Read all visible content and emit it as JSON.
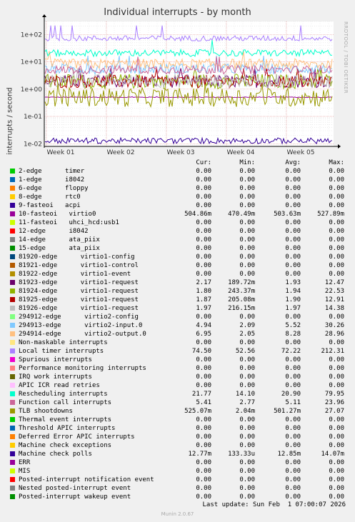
{
  "chart_data": {
    "type": "line",
    "title": "Individual interrupts - by month",
    "ylabel": "interrupts / second",
    "yscale": "log",
    "ylim": [
      0.008,
      300
    ],
    "yticks": [
      "1e+02",
      "1e+01",
      "1e+00",
      "1e-01",
      "1e-02"
    ],
    "ytick_values": [
      100,
      10,
      1,
      0.1,
      0.01
    ],
    "xticks": [
      "Week 01",
      "Week 02",
      "Week 03",
      "Week 04",
      "Week 05"
    ],
    "grid": true,
    "legend_headers": {
      "cur": "Cur:",
      "min": "Min:",
      "avg": "Avg:",
      "max": "Max:"
    },
    "series": [
      {
        "name": "2-edge      timer",
        "color": "#00cc00",
        "cur": "0.00",
        "min": "0.00",
        "avg": "0.00",
        "max": "0.00"
      },
      {
        "name": "1-edge      i8042",
        "color": "#0066b3",
        "cur": "0.00",
        "min": "0.00",
        "avg": "0.00",
        "max": "0.00"
      },
      {
        "name": "6-edge      floppy",
        "color": "#ff8000",
        "cur": "0.00",
        "min": "0.00",
        "avg": "0.00",
        "max": "0.00"
      },
      {
        "name": "8-edge      rtc0",
        "color": "#ffcc00",
        "cur": "0.00",
        "min": "0.00",
        "avg": "0.00",
        "max": "0.00"
      },
      {
        "name": "9-fasteoi   acpi",
        "color": "#330099",
        "cur": "0.00",
        "min": "0.00",
        "avg": "0.00",
        "max": "0.00"
      },
      {
        "name": "10-fasteoi   virtio0",
        "color": "#990099",
        "cur": "504.86m",
        "min": "470.49m",
        "avg": "503.63m",
        "max": "527.89m"
      },
      {
        "name": "11-fasteoi   uhci_hcd:usb1",
        "color": "#ccff00",
        "cur": "0.00",
        "min": "0.00",
        "avg": "0.00",
        "max": "0.00"
      },
      {
        "name": "12-edge      i8042",
        "color": "#ff0000",
        "cur": "0.00",
        "min": "0.00",
        "avg": "0.00",
        "max": "0.00"
      },
      {
        "name": "14-edge      ata_piix",
        "color": "#808080",
        "cur": "0.00",
        "min": "0.00",
        "avg": "0.00",
        "max": "0.00"
      },
      {
        "name": "15-edge      ata_piix",
        "color": "#008f00",
        "cur": "0.00",
        "min": "0.00",
        "avg": "0.00",
        "max": "0.00"
      },
      {
        "name": "81920-edge      virtio1-config",
        "color": "#00487d",
        "cur": "0.00",
        "min": "0.00",
        "avg": "0.00",
        "max": "0.00"
      },
      {
        "name": "81921-edge      virtio1-control",
        "color": "#b35a00",
        "cur": "0.00",
        "min": "0.00",
        "avg": "0.00",
        "max": "0.00"
      },
      {
        "name": "81922-edge      virtio1-event",
        "color": "#b38f00",
        "cur": "0.00",
        "min": "0.00",
        "avg": "0.00",
        "max": "0.00"
      },
      {
        "name": "81923-edge      virtio1-request",
        "color": "#6b006b",
        "cur": "2.17",
        "min": "189.72m",
        "avg": "1.93",
        "max": "12.47"
      },
      {
        "name": "81924-edge      virtio1-request",
        "color": "#8fb300",
        "cur": "1.80",
        "min": "243.37m",
        "avg": "1.94",
        "max": "22.53"
      },
      {
        "name": "81925-edge      virtio1-request",
        "color": "#b30000",
        "cur": "1.87",
        "min": "205.08m",
        "avg": "1.90",
        "max": "12.91"
      },
      {
        "name": "81926-edge      virtio1-request",
        "color": "#bebebe",
        "cur": "1.97",
        "min": "216.15m",
        "avg": "1.97",
        "max": "14.38"
      },
      {
        "name": "294912-edge      virtio2-config",
        "color": "#80ff80",
        "cur": "0.00",
        "min": "0.00",
        "avg": "0.00",
        "max": "0.00"
      },
      {
        "name": "294913-edge      virtio2-input.0",
        "color": "#80c9ff",
        "cur": "4.94",
        "min": "2.09",
        "avg": "5.52",
        "max": "30.26"
      },
      {
        "name": "294914-edge      virtio2-output.0",
        "color": "#ffc080",
        "cur": "6.95",
        "min": "2.05",
        "avg": "8.28",
        "max": "28.96"
      },
      {
        "name": "Non-maskable interrupts",
        "color": "#ffe680",
        "cur": "0.00",
        "min": "0.00",
        "avg": "0.00",
        "max": "0.00"
      },
      {
        "name": "Local timer interrupts",
        "color": "#aa80ff",
        "cur": "74.50",
        "min": "52.56",
        "avg": "72.22",
        "max": "212.31"
      },
      {
        "name": "Spurious interrupts",
        "color": "#ee00cc",
        "cur": "0.00",
        "min": "0.00",
        "avg": "0.00",
        "max": "0.00"
      },
      {
        "name": "Performance monitoring interrupts",
        "color": "#ff8080",
        "cur": "0.00",
        "min": "0.00",
        "avg": "0.00",
        "max": "0.00"
      },
      {
        "name": "IRQ work interrupts",
        "color": "#666600",
        "cur": "0.00",
        "min": "0.00",
        "avg": "0.00",
        "max": "0.00"
      },
      {
        "name": "APIC ICR read retries",
        "color": "#ffbfff",
        "cur": "0.00",
        "min": "0.00",
        "avg": "0.00",
        "max": "0.00"
      },
      {
        "name": "Rescheduling interrupts",
        "color": "#00ffcc",
        "cur": "21.77",
        "min": "14.10",
        "avg": "20.90",
        "max": "79.95"
      },
      {
        "name": "Function call interrupts",
        "color": "#cc6699",
        "cur": "5.41",
        "min": "2.77",
        "avg": "5.11",
        "max": "23.96"
      },
      {
        "name": "TLB shootdowns",
        "color": "#999900",
        "cur": "525.07m",
        "min": "2.04m",
        "avg": "501.27m",
        "max": "27.07"
      },
      {
        "name": "Thermal event interrupts",
        "color": "#00cc00",
        "cur": "0.00",
        "min": "0.00",
        "avg": "0.00",
        "max": "0.00"
      },
      {
        "name": "Threshold APIC interrupts",
        "color": "#0066b3",
        "cur": "0.00",
        "min": "0.00",
        "avg": "0.00",
        "max": "0.00"
      },
      {
        "name": "Deferred Error APIC interrupts",
        "color": "#ff8000",
        "cur": "0.00",
        "min": "0.00",
        "avg": "0.00",
        "max": "0.00"
      },
      {
        "name": "Machine check exceptions",
        "color": "#ffcc00",
        "cur": "0.00",
        "min": "0.00",
        "avg": "0.00",
        "max": "0.00"
      },
      {
        "name": "Machine check polls",
        "color": "#330099",
        "cur": "12.77m",
        "min": "133.33u",
        "avg": "12.85m",
        "max": "14.07m"
      },
      {
        "name": "ERR",
        "color": "#990099",
        "cur": "0.00",
        "min": "0.00",
        "avg": "0.00",
        "max": "0.00"
      },
      {
        "name": "MIS",
        "color": "#ccff00",
        "cur": "0.00",
        "min": "0.00",
        "avg": "0.00",
        "max": "0.00"
      },
      {
        "name": "Posted-interrupt notification event",
        "color": "#ff0000",
        "cur": "0.00",
        "min": "0.00",
        "avg": "0.00",
        "max": "0.00"
      },
      {
        "name": "Nested posted-interrupt event",
        "color": "#808080",
        "cur": "0.00",
        "min": "0.00",
        "avg": "0.00",
        "max": "0.00"
      },
      {
        "name": "Posted-interrupt wakeup event",
        "color": "#008f00",
        "cur": "0.00",
        "min": "0.00",
        "avg": "0.00",
        "max": "0.00"
      }
    ]
  },
  "side_credit": "RRDTOOL / TOBI OETIKER",
  "last_update": "Last update: Sun Feb  1 07:00:07 2026",
  "munin_version": "Munin 2.0.67"
}
